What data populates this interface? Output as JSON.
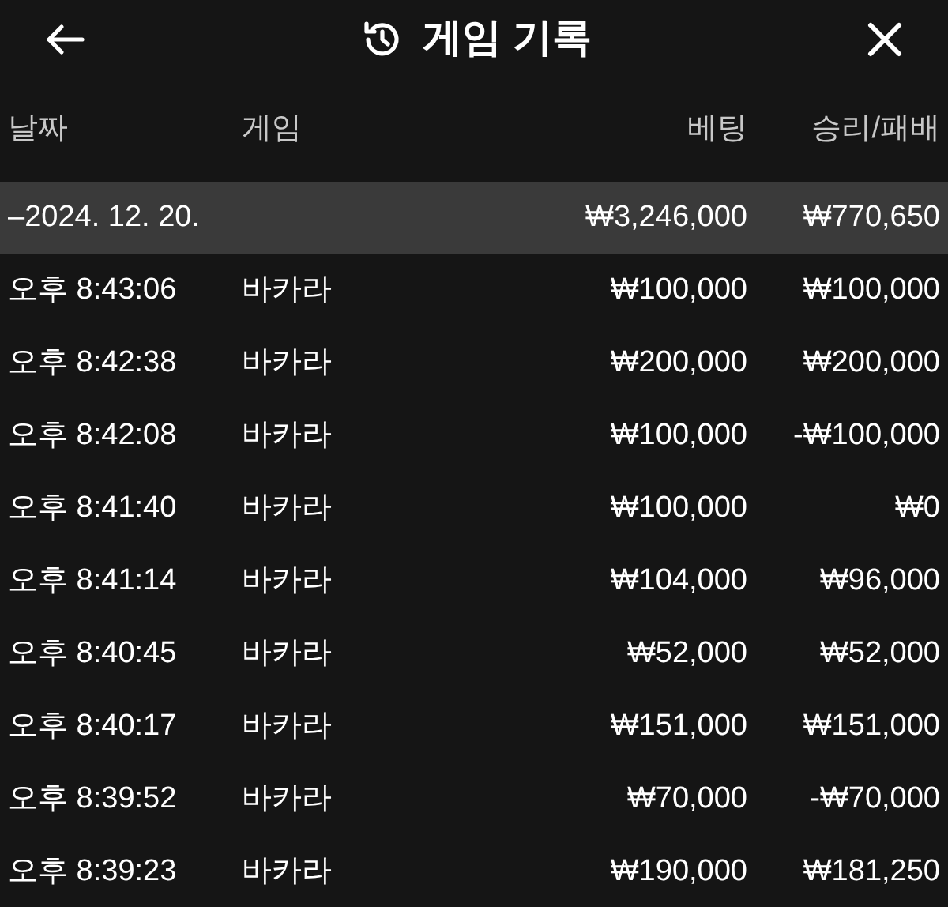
{
  "header": {
    "title": "게임 기록"
  },
  "columns": [
    "날짜",
    "게임",
    "베팅",
    "승리/패배"
  ],
  "summary": {
    "date": "–2024. 12. 20.",
    "bet": "₩3,246,000",
    "result": "₩770,650"
  },
  "rows": [
    {
      "time": "오후 8:43:06",
      "game": "바카라",
      "bet": "₩100,000",
      "result": "₩100,000"
    },
    {
      "time": "오후 8:42:38",
      "game": "바카라",
      "bet": "₩200,000",
      "result": "₩200,000"
    },
    {
      "time": "오후 8:42:08",
      "game": "바카라",
      "bet": "₩100,000",
      "result": "-₩100,000"
    },
    {
      "time": "오후 8:41:40",
      "game": "바카라",
      "bet": "₩100,000",
      "result": "₩0"
    },
    {
      "time": "오후 8:41:14",
      "game": "바카라",
      "bet": "₩104,000",
      "result": "₩96,000"
    },
    {
      "time": "오후 8:40:45",
      "game": "바카라",
      "bet": "₩52,000",
      "result": "₩52,000"
    },
    {
      "time": "오후 8:40:17",
      "game": "바카라",
      "bet": "₩151,000",
      "result": "₩151,000"
    },
    {
      "time": "오후 8:39:52",
      "game": "바카라",
      "bet": "₩70,000",
      "result": "-₩70,000"
    },
    {
      "time": "오후 8:39:23",
      "game": "바카라",
      "bet": "₩190,000",
      "result": "₩181,250"
    }
  ]
}
